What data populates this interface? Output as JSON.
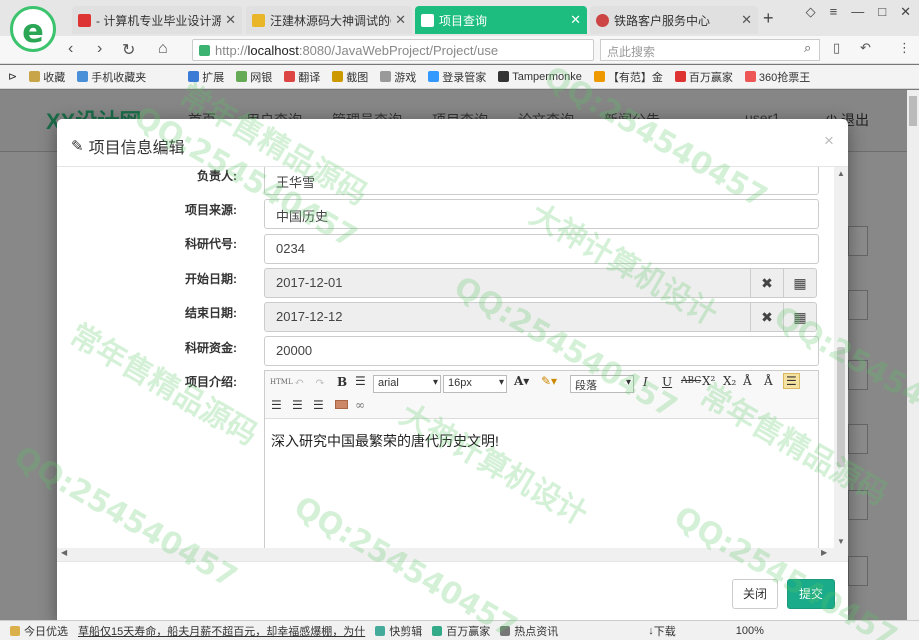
{
  "browser": {
    "tabs": [
      {
        "title": "- 计算机专业毕业设计源",
        "active": false,
        "icon_color": "#d33"
      },
      {
        "title": "汪建林源码大神调试的Q",
        "active": false,
        "icon_color": "#e8b628"
      },
      {
        "title": "项目查询",
        "active": true,
        "icon_color": "#ffffff"
      },
      {
        "title": "铁路客户服务中心",
        "active": false,
        "icon_color": "#c44"
      }
    ],
    "new_tab": "+",
    "url_host": "localhost",
    "url_rest": ":8080/JavaWebProject/Project/use",
    "url_prefix": "http://",
    "search_placeholder": "点此搜索",
    "bookmarks": [
      "收藏",
      "手机收藏夹",
      "扩展",
      "网银",
      "翻译",
      "截图",
      "游戏",
      "登录管家",
      "Tampermonke",
      "【有范】金",
      "百万赢家",
      "360抢票王"
    ]
  },
  "site": {
    "brand": "XX设计网",
    "nav": [
      "首页",
      "用户查询",
      "管理员查询",
      "项目查询",
      "论文查询",
      "新闻公告"
    ],
    "user": "user1",
    "logout": "退出"
  },
  "modal": {
    "title": "项目信息编辑",
    "close": "×",
    "fields": [
      {
        "label": "负责人:",
        "value": "王华雪",
        "type": "text"
      },
      {
        "label": "项目来源:",
        "value": "中国历史",
        "type": "text"
      },
      {
        "label": "科研代号:",
        "value": "0234",
        "type": "text"
      },
      {
        "label": "开始日期:",
        "value": "2017-12-01",
        "type": "date"
      },
      {
        "label": "结束日期:",
        "value": "2017-12-12",
        "type": "date"
      },
      {
        "label": "科研资金:",
        "value": "20000",
        "type": "text"
      }
    ],
    "editor": {
      "label": "项目介绍:",
      "font": "arial",
      "size": "16px",
      "paragraph": "段落",
      "content": "深入研究中国最繁荣的唐代历史文明!"
    },
    "close_button": "关闭",
    "submit_button": "提交"
  },
  "statusbar": {
    "items": [
      "今日优选",
      "草船仅15天寿命，船夫月薪不超百元，却幸福感爆棚，为什",
      "快剪辑",
      "百万赢家",
      "热点资讯",
      "下载"
    ],
    "zoom": "100%"
  },
  "watermark": {
    "lines": [
      "QQ:254540457",
      "大神计算机设计",
      "常年售精品源码"
    ]
  }
}
